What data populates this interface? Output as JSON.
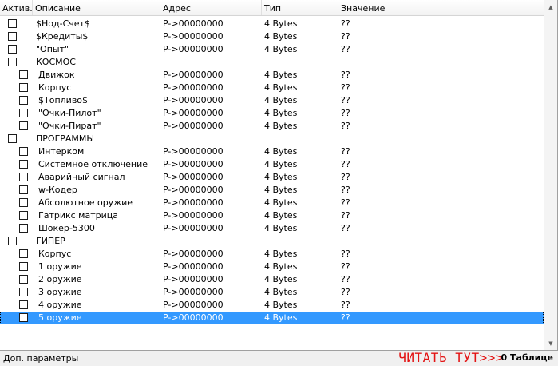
{
  "columns": {
    "active": "Актив.",
    "description": "Описание",
    "address": "Адрес",
    "type": "Тип",
    "value": "Значение"
  },
  "rows": [
    {
      "desc": "$Нод-Счет$",
      "addr": "P->00000000",
      "type": "4 Bytes",
      "val": "??",
      "group": false,
      "child": false,
      "selected": false
    },
    {
      "desc": "$Кредиты$",
      "addr": "P->00000000",
      "type": "4 Bytes",
      "val": "??",
      "group": false,
      "child": false,
      "selected": false
    },
    {
      "desc": "\"Опыт\"",
      "addr": "P->00000000",
      "type": "4 Bytes",
      "val": "??",
      "group": false,
      "child": false,
      "selected": false
    },
    {
      "desc": "КОСМОС",
      "addr": "",
      "type": "",
      "val": "",
      "group": true,
      "child": false,
      "selected": false
    },
    {
      "desc": "Движок",
      "addr": "P->00000000",
      "type": "4 Bytes",
      "val": "??",
      "group": false,
      "child": true,
      "selected": false
    },
    {
      "desc": "Корпус",
      "addr": "P->00000000",
      "type": "4 Bytes",
      "val": "??",
      "group": false,
      "child": true,
      "selected": false
    },
    {
      "desc": "$Топливо$",
      "addr": "P->00000000",
      "type": "4 Bytes",
      "val": "??",
      "group": false,
      "child": true,
      "selected": false
    },
    {
      "desc": "\"Очки-Пилот\"",
      "addr": "P->00000000",
      "type": "4 Bytes",
      "val": "??",
      "group": false,
      "child": true,
      "selected": false
    },
    {
      "desc": "\"Очки-Пират\"",
      "addr": "P->00000000",
      "type": "4 Bytes",
      "val": "??",
      "group": false,
      "child": true,
      "selected": false
    },
    {
      "desc": "ПРОГРАММЫ",
      "addr": "",
      "type": "",
      "val": "",
      "group": true,
      "child": false,
      "selected": false
    },
    {
      "desc": "Интерком",
      "addr": "P->00000000",
      "type": "4 Bytes",
      "val": "??",
      "group": false,
      "child": true,
      "selected": false
    },
    {
      "desc": "Системное отключение",
      "addr": "P->00000000",
      "type": "4 Bytes",
      "val": "??",
      "group": false,
      "child": true,
      "selected": false
    },
    {
      "desc": "Аварийный сигнал",
      "addr": "P->00000000",
      "type": "4 Bytes",
      "val": "??",
      "group": false,
      "child": true,
      "selected": false
    },
    {
      "desc": "w-Кодер",
      "addr": "P->00000000",
      "type": "4 Bytes",
      "val": "??",
      "group": false,
      "child": true,
      "selected": false
    },
    {
      "desc": "Абсолютное оружие",
      "addr": "P->00000000",
      "type": "4 Bytes",
      "val": "??",
      "group": false,
      "child": true,
      "selected": false
    },
    {
      "desc": "Гатрикс матрица",
      "addr": "P->00000000",
      "type": "4 Bytes",
      "val": "??",
      "group": false,
      "child": true,
      "selected": false
    },
    {
      "desc": "Шокер-5300",
      "addr": "P->00000000",
      "type": "4 Bytes",
      "val": "??",
      "group": false,
      "child": true,
      "selected": false
    },
    {
      "desc": "ГИПЕР",
      "addr": "",
      "type": "",
      "val": "",
      "group": true,
      "child": false,
      "selected": false
    },
    {
      "desc": "Корпус",
      "addr": "P->00000000",
      "type": "4 Bytes",
      "val": "??",
      "group": false,
      "child": true,
      "selected": false
    },
    {
      "desc": "1 оружие",
      "addr": "P->00000000",
      "type": "4 Bytes",
      "val": "??",
      "group": false,
      "child": true,
      "selected": false
    },
    {
      "desc": "2 оружие",
      "addr": "P->00000000",
      "type": "4 Bytes",
      "val": "??",
      "group": false,
      "child": true,
      "selected": false
    },
    {
      "desc": "3 оружие",
      "addr": "P->00000000",
      "type": "4 Bytes",
      "val": "??",
      "group": false,
      "child": true,
      "selected": false
    },
    {
      "desc": "4 оружие",
      "addr": "P->00000000",
      "type": "4 Bytes",
      "val": "??",
      "group": false,
      "child": true,
      "selected": false
    },
    {
      "desc": "5 оружие",
      "addr": "P->00000000",
      "type": "4 Bytes",
      "val": "??",
      "group": false,
      "child": true,
      "selected": true
    }
  ],
  "scrollbar": {
    "up_icon": "scroll-up-arrow",
    "down_icon": "scroll-down-arrow"
  },
  "status": {
    "label": "Доп. параметры",
    "link": "ЧИТАТЬ ТУТ>>>",
    "count": "0 Таблице"
  },
  "colors": {
    "selection": "#3399ff",
    "link": "#e31515"
  }
}
